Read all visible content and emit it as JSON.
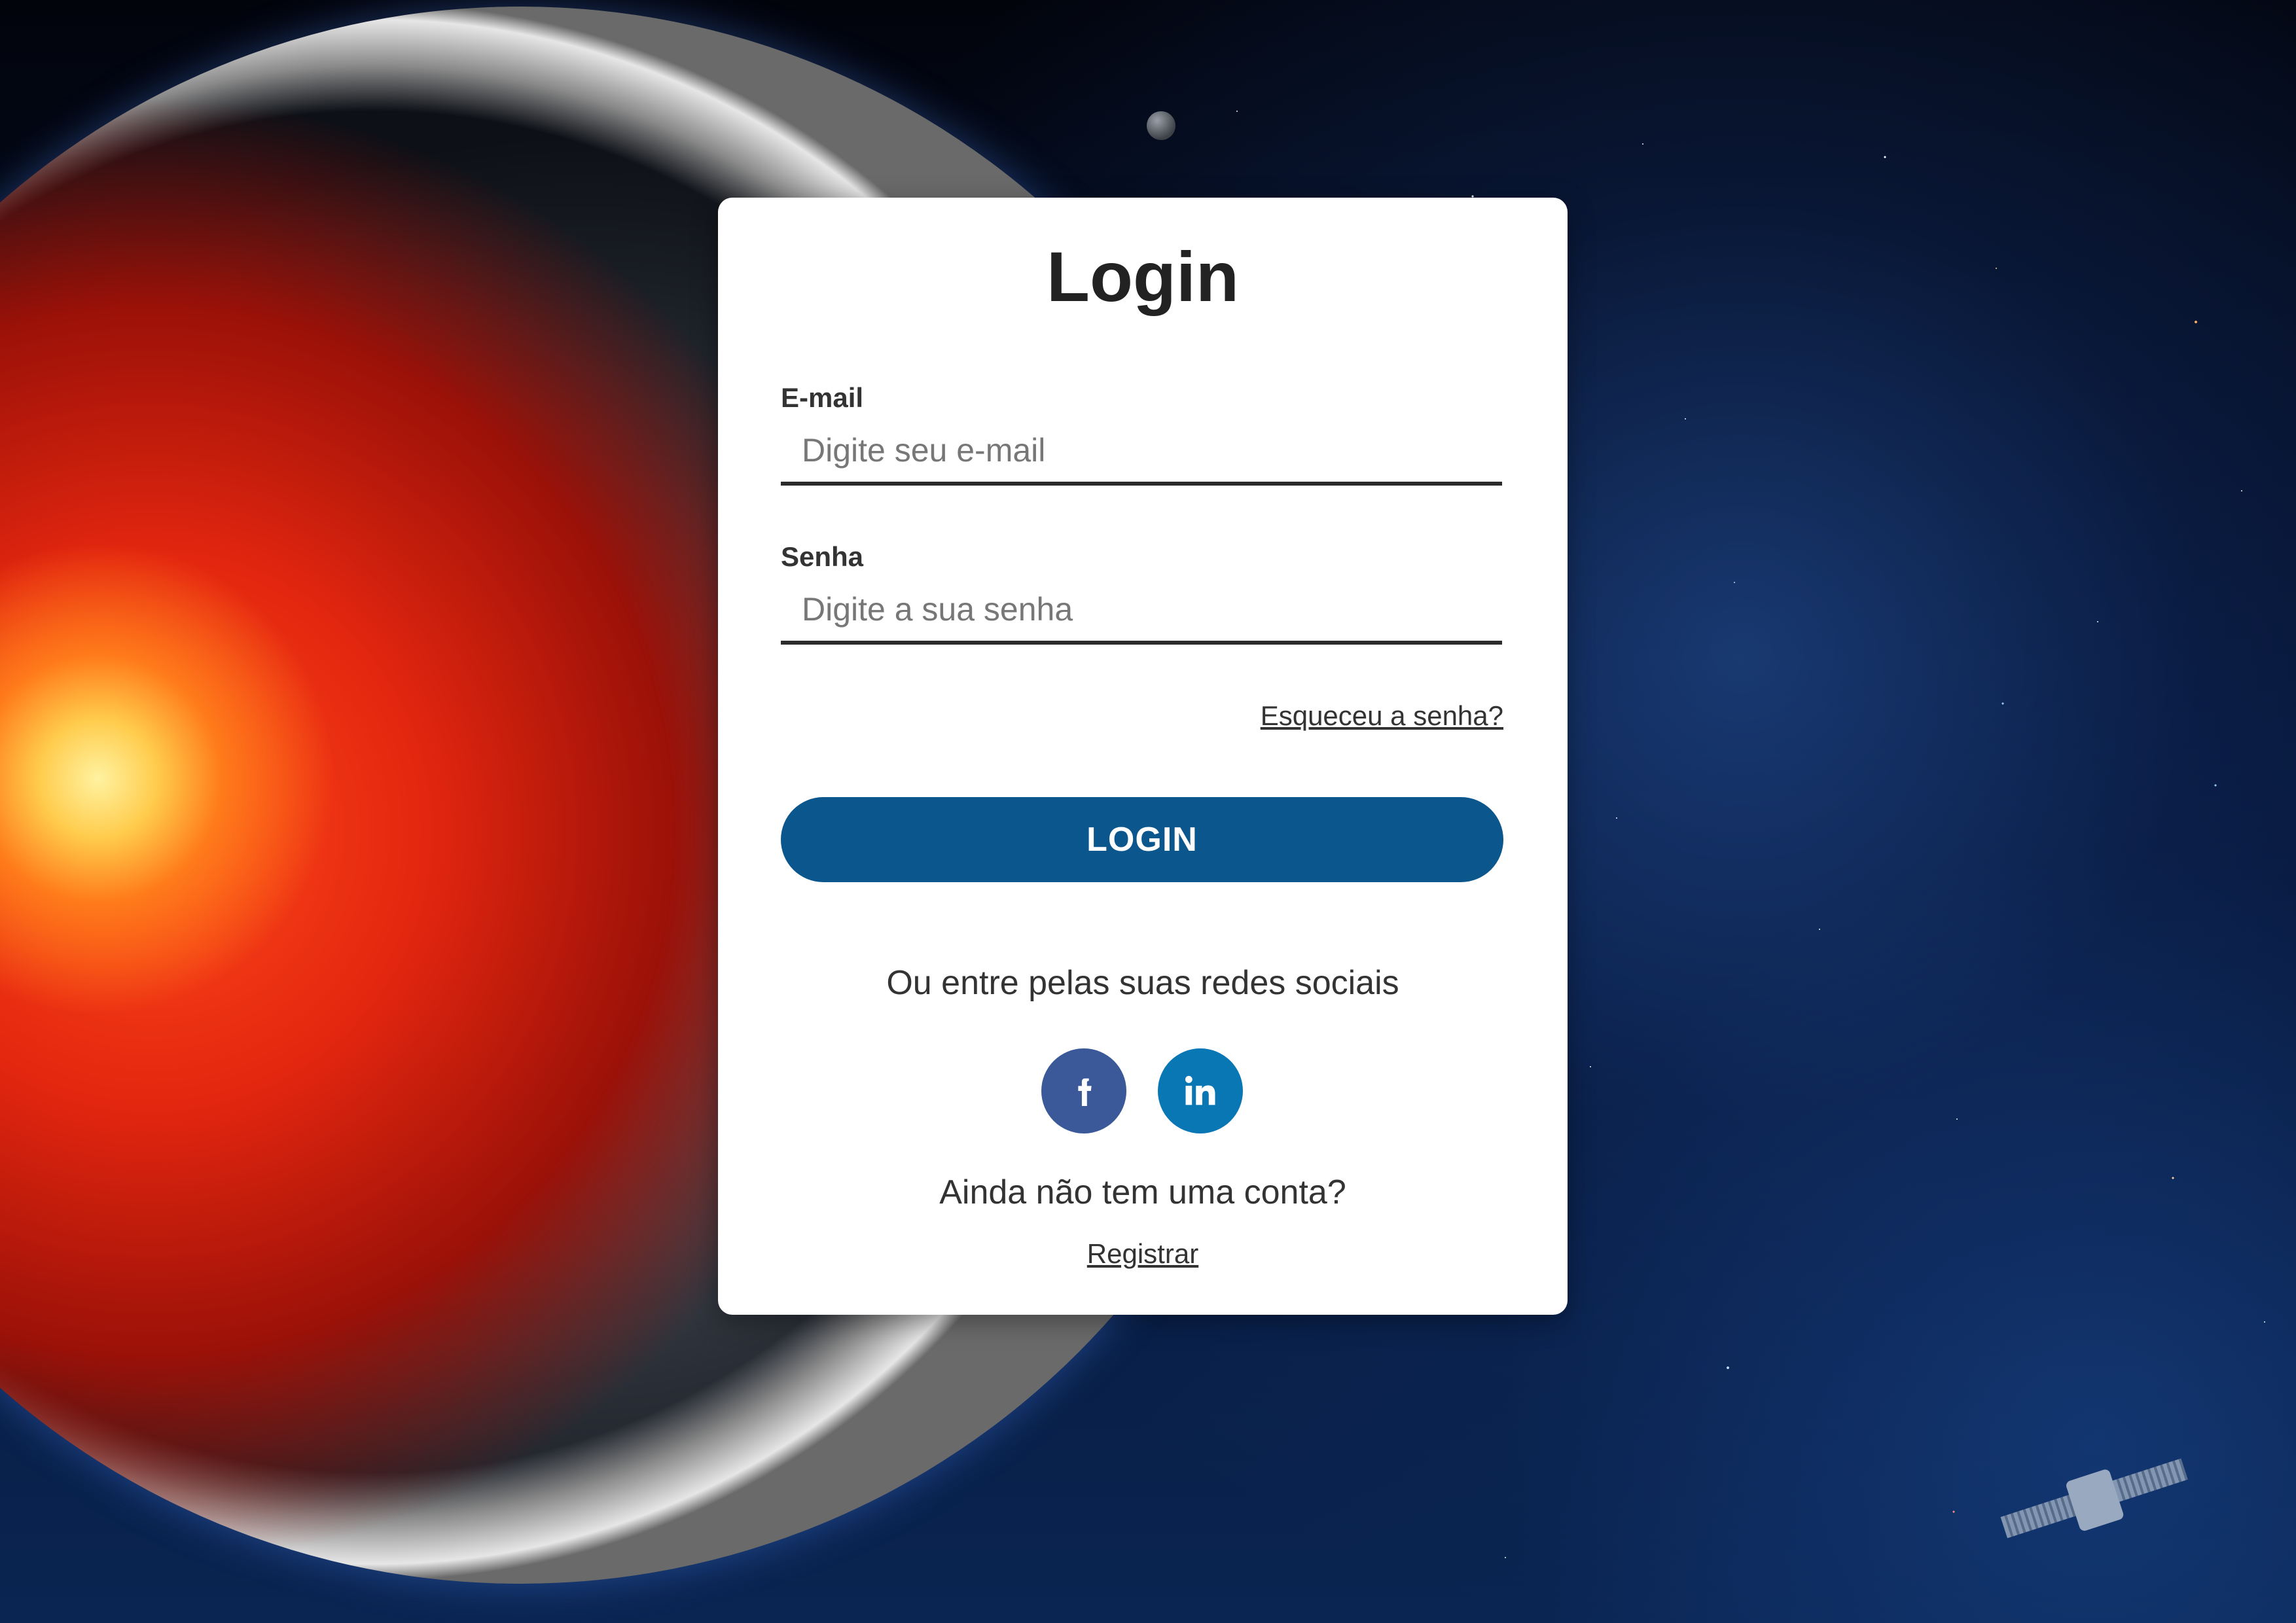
{
  "login_card": {
    "title": "Login",
    "email": {
      "label": "E-mail",
      "placeholder": "Digite seu e-mail",
      "value": ""
    },
    "password": {
      "label": "Senha",
      "placeholder": "Digite a sua senha",
      "value": ""
    },
    "forgot_password_link": "Esqueceu a senha?",
    "login_button": "LOGIN",
    "social_prompt": "Ou entre pelas suas redes sociais",
    "social_buttons": [
      {
        "icon": "facebook-icon",
        "color": "#3b5998"
      },
      {
        "icon": "linkedin-icon",
        "color": "#0a77b5"
      }
    ],
    "no_account_text": "Ainda não tem uma conta?",
    "register_link": "Registrar"
  },
  "colors": {
    "accent": "#0b568c",
    "card_background": "#ffffff",
    "text": "#333333"
  }
}
